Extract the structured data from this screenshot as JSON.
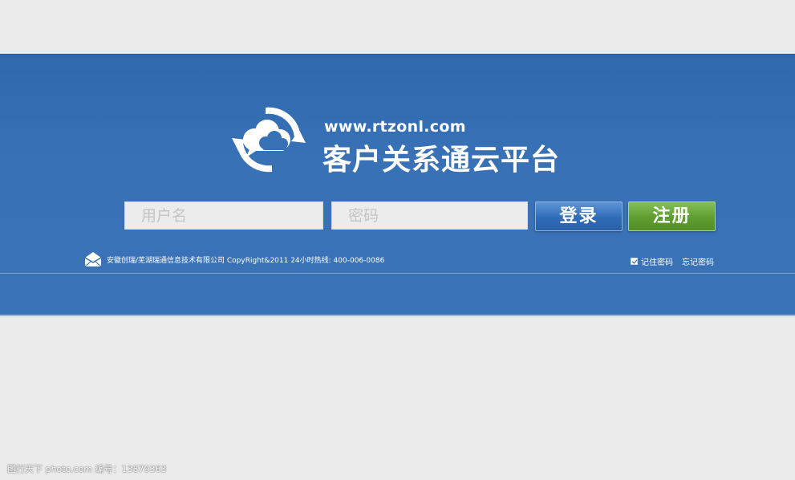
{
  "header": {
    "site_url": "www.rtzonl.com",
    "title": "客户关系通云平台",
    "logo_icon": "cloud-refresh-icon"
  },
  "login_form": {
    "username_placeholder": "用户名",
    "password_placeholder": "密码",
    "login_label": "登录",
    "register_label": "注册"
  },
  "footer": {
    "mail_icon": "mail-icon",
    "copyright": "安徽创瑞/芜湖瑞通信息技术有限公司 CopyRight&2011 24小时热线: 400-006-0086",
    "remember_label": "记住密码",
    "remember_checked": true,
    "forgot_label": "忘记密码"
  },
  "watermark": {
    "text": "图行天下 photo.com 编号：13879363"
  },
  "colors": {
    "band": "#3871b5",
    "page_bg": "#ebebec",
    "login_button": "#2f6cb8",
    "register_button": "#5e9d2f"
  }
}
